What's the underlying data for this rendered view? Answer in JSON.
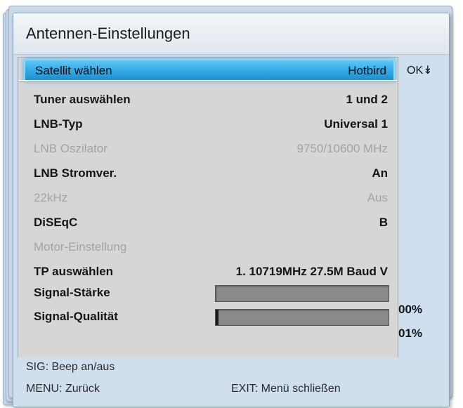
{
  "window": {
    "title": "Antennen-Einstellungen"
  },
  "settings": {
    "rows": [
      {
        "label": "Satellit wählen",
        "value": "Hotbird",
        "state": "selected"
      },
      {
        "label": "Tuner auswählen",
        "value": "1 und 2",
        "state": "enabled"
      },
      {
        "label": "LNB-Typ",
        "value": "Universal 1",
        "state": "enabled"
      },
      {
        "label": "LNB Oszilator",
        "value": "9750/10600 MHz",
        "state": "disabled"
      },
      {
        "label": "LNB Stromver.",
        "value": "An",
        "state": "enabled"
      },
      {
        "label": "22kHz",
        "value": "Aus",
        "state": "disabled"
      },
      {
        "label": "DiSEqC",
        "value": "B",
        "state": "enabled"
      },
      {
        "label": "Motor-Einstellung",
        "value": "",
        "state": "disabled"
      },
      {
        "label": "TP auswählen",
        "value": "1. 10719MHz 27.5M Baud V",
        "state": "enabled"
      }
    ],
    "ok_hint": "OK↡"
  },
  "signal": {
    "strength_label": "Signal-Stärke",
    "strength_percent": "00%",
    "strength_value": 0,
    "quality_label": "Signal-Qualität",
    "quality_percent": "01%",
    "quality_value": 1
  },
  "footer": {
    "sig_hint": "SIG: Beep an/aus",
    "menu_hint": "MENU: Zurück",
    "exit_hint": "EXIT: Menü schließen"
  },
  "colors": {
    "selection": "#35a9e5",
    "panel": "#d6d6d6",
    "window_bg": "#cfdff0",
    "disabled_text": "#a3a3a3"
  }
}
